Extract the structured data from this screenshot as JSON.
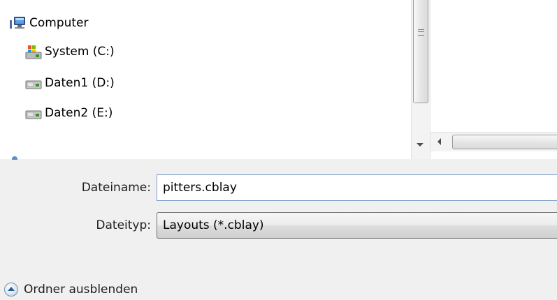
{
  "tree": {
    "items": [
      {
        "label": "Computer",
        "icon": "computer-icon"
      },
      {
        "label": "System (C:)",
        "icon": "system-drive-icon"
      },
      {
        "label": "Daten1 (D:)",
        "icon": "drive-icon"
      },
      {
        "label": "Daten2 (E:)",
        "icon": "drive-icon"
      }
    ]
  },
  "form": {
    "filename_label": "Dateiname:",
    "filename_value": "pitters.cblay",
    "filetype_label": "Dateityp:",
    "filetype_value": "Layouts (*.cblay)"
  },
  "footer": {
    "hide_folders_label": "Ordner ausblenden"
  }
}
